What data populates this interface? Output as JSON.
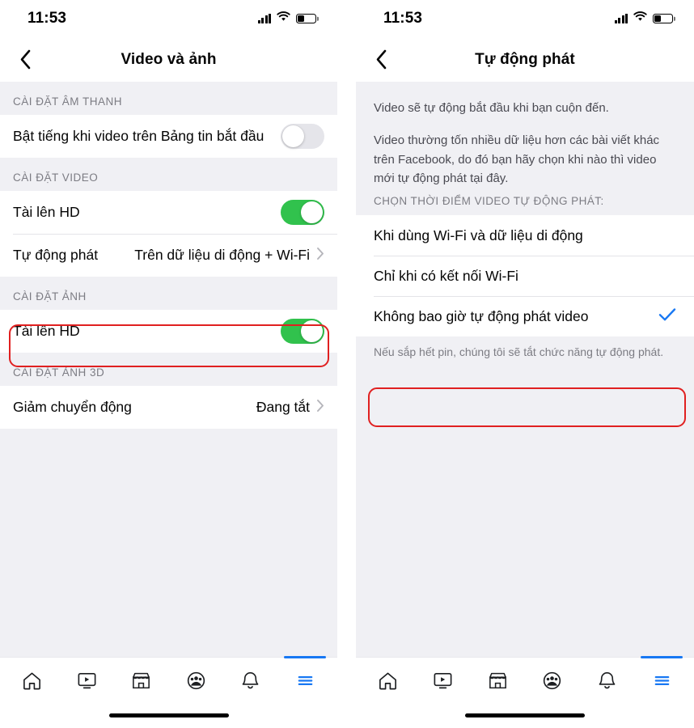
{
  "status_bar": {
    "time": "11:53",
    "signal_icon": "cellular-signal-icon",
    "wifi_icon": "wifi-icon",
    "battery_icon": "battery-icon",
    "battery_level_percent": 40
  },
  "colors": {
    "toggle_on": "#31c24d",
    "toggle_off": "#e5e5ea",
    "accent_blue": "#1878f3",
    "highlight_red": "#e02020",
    "page_background": "#f0f0f4",
    "row_background": "#ffffff",
    "primary_text": "#050505",
    "secondary_text": "#7c7c83"
  },
  "left_screen": {
    "nav": {
      "back_icon": "chevron-left-icon",
      "title": "Video và ảnh"
    },
    "sections": [
      {
        "header": "CÀI ĐẶT ÂM THANH",
        "rows": [
          {
            "label": "Bật tiếng khi video trên Bảng tin bắt đầu",
            "control": "toggle",
            "toggle_state": "off"
          }
        ]
      },
      {
        "header": "CÀI ĐẶT VIDEO",
        "rows": [
          {
            "label": "Tài lên HD",
            "control": "toggle",
            "toggle_state": "on"
          },
          {
            "label": "Tự động phát",
            "control": "disclosure",
            "value": "Trên dữ liệu di động + Wi-Fi",
            "chevron_icon": "chevron-right-icon",
            "highlighted": true
          }
        ]
      },
      {
        "header": "CÀI ĐẶT ẢNH",
        "rows": [
          {
            "label": "Tài lên HD",
            "control": "toggle",
            "toggle_state": "on"
          }
        ]
      },
      {
        "header": "CÀI ĐẶT ẢNH 3D",
        "rows": [
          {
            "label": "Giảm chuyển động",
            "control": "disclosure",
            "value": "Đang tắt",
            "chevron_icon": "chevron-right-icon"
          }
        ]
      }
    ]
  },
  "right_screen": {
    "nav": {
      "back_icon": "chevron-left-icon",
      "title": "Tự động phát"
    },
    "description": [
      "Video sẽ tự động bắt đầu khi bạn cuộn đến.",
      "Video thường tốn nhiều dữ liệu hơn các bài viết khác trên Facebook, do đó bạn hãy chọn khi nào thì video mới tự động phát tại đây."
    ],
    "options_header": "CHỌN THỜI ĐIỂM VIDEO TỰ ĐỘNG PHÁT:",
    "options": [
      {
        "label": "Khi dùng Wi-Fi và dữ liệu di động",
        "selected": false
      },
      {
        "label": "Chỉ khi có kết nối Wi-Fi",
        "selected": false
      },
      {
        "label": "Không bao giờ tự động phát video",
        "selected": true,
        "check_icon": "check-icon",
        "highlighted": true
      }
    ],
    "footnote": "Nếu sắp hết pin, chúng tôi sẽ tắt chức năng tự động phát."
  },
  "tab_bar": {
    "tabs": [
      {
        "name": "home-tab",
        "icon": "home-icon",
        "active": false
      },
      {
        "name": "video-tab",
        "icon": "video-play-icon",
        "active": false
      },
      {
        "name": "marketplace-tab",
        "icon": "storefront-icon",
        "active": false
      },
      {
        "name": "groups-tab",
        "icon": "groups-icon",
        "active": false
      },
      {
        "name": "notifications-tab",
        "icon": "bell-icon",
        "active": false
      },
      {
        "name": "menu-tab",
        "icon": "hamburger-menu-icon",
        "active": true
      }
    ],
    "home_indicator": "home-indicator-bar"
  }
}
